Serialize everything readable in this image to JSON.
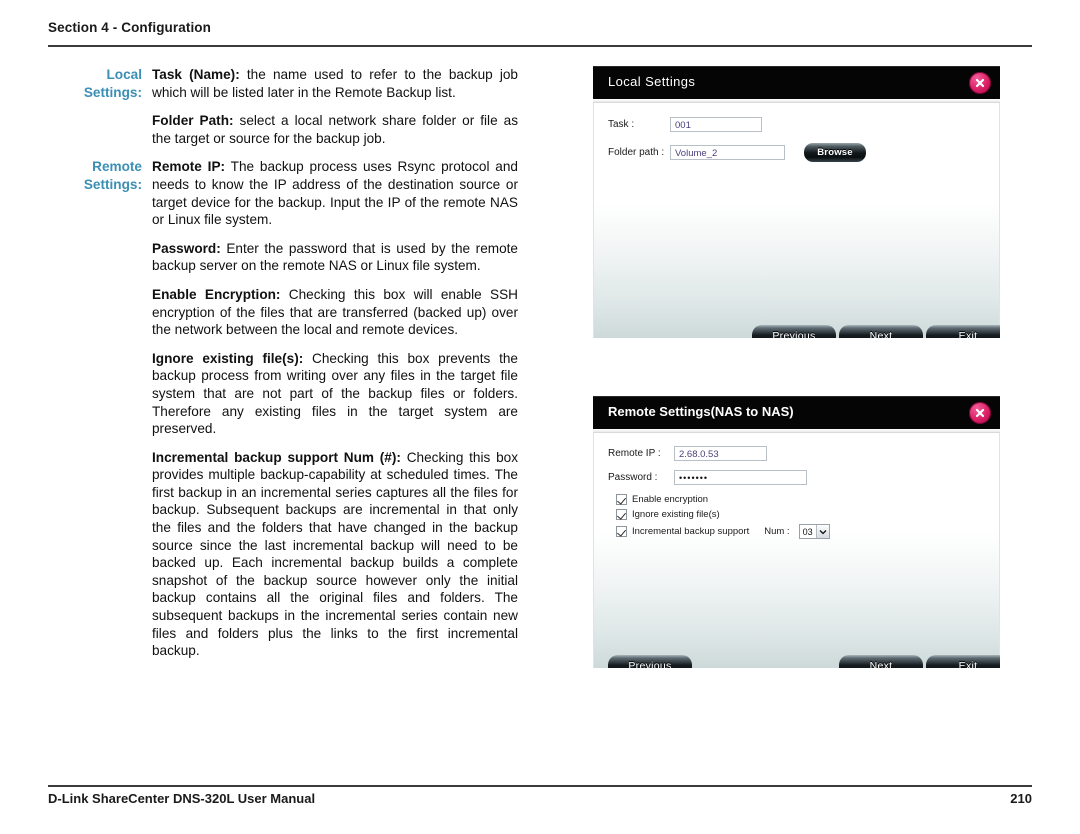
{
  "header": {
    "section_title": "Section 4 - Configuration"
  },
  "footer": {
    "left": "D-Link ShareCenter DNS-320L User Manual",
    "right": "210"
  },
  "colors": {
    "label_accent": "#3b8fb5",
    "titlebar": "#050505",
    "close_button": "#d81f63"
  },
  "doc": {
    "local_label_line1": "Local",
    "local_label_line2": "Settings:",
    "remote_label_line1": "Remote",
    "remote_label_line2": "Settings:",
    "task_term": "Task (Name):",
    "task_text": " the name used to refer to the backup job which will be listed later in the Remote Backup list.",
    "folder_term": "Folder Path:",
    "folder_text": " select a local network share folder or file as the target or source for the backup job.",
    "remote_ip_term": "Remote IP:",
    "remote_ip_text": " The backup process uses Rsync protocol and needs to know the IP address of the destination source or target device for the backup. Input the IP of the remote NAS or Linux file system.",
    "password_term": "Password:",
    "password_text": " Enter the password that is used by the remote backup server on the remote NAS or Linux file system.",
    "encryption_term": "Enable Encryption:",
    "encryption_text": " Checking this box will enable SSH encryption of the files that are transferred (backed up) over the network between the local and remote devices.",
    "ignore_term": "Ignore existing file(s):",
    "ignore_text": " Checking this box prevents the backup process from writing over any files in the target file system that are not part of the backup files or folders. Therefore any existing files in the target system are preserved.",
    "incremental_term": "Incremental backup support Num (#):",
    "incremental_text": " Checking this box provides multiple backup-capability at scheduled times. The first backup in an incremental series captures all the files for backup. Subsequent backups are incremental in that only the files and the folders that have changed in the backup source since the last incremental backup will need to be backed up. Each incremental backup builds a complete snapshot of the backup source however only the initial backup contains all the original files and folders. The subsequent backups in the incremental series contain new files and folders plus the links to the first incremental backup."
  },
  "dialog_local": {
    "title": "Local Settings",
    "close_icon": "close-icon",
    "task_label": "Task :",
    "task_value": "001",
    "folder_label": "Folder path :",
    "folder_value": "Volume_2",
    "browse_label": "Browse",
    "previous_label": "Previous",
    "next_label": "Next",
    "exit_label": "Exit"
  },
  "dialog_remote": {
    "title": "Remote Settings(NAS to NAS)",
    "close_icon": "close-icon",
    "remote_ip_label": "Remote IP :",
    "remote_ip_value": "2.68.0.53",
    "password_label": "Password :",
    "password_value": "•••••••",
    "chk_encryption": "Enable encryption",
    "chk_ignore": "Ignore existing file(s)",
    "chk_incremental": "Incremental backup support",
    "num_label": "Num :",
    "num_value": "03",
    "previous_label": "Previous",
    "next_label": "Next",
    "exit_label": "Exit"
  }
}
